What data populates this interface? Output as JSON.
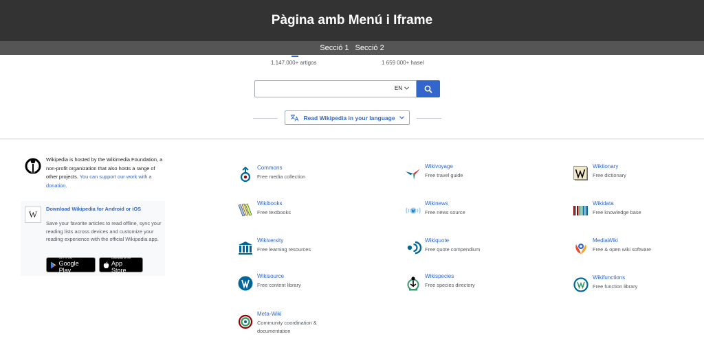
{
  "header": {
    "title": "Pàgina amb Menú i Iframe"
  },
  "nav": {
    "items": [
      "Secció 1",
      "Secció 2"
    ]
  },
  "stats": [
    {
      "text": "1.147.000+ artigos"
    },
    {
      "text": "1 659 000+ hasel"
    }
  ],
  "search": {
    "placeholder": "",
    "language": "EN"
  },
  "read_language_label": "Read Wikipedia in your language",
  "hosted": {
    "text": "Wikipedia is hosted by the Wikimedia Foundation, a non-profit organization that also hosts a range of other projects.",
    "link": "You can support our work with a donation."
  },
  "app": {
    "logo_letter": "W",
    "title": "Download Wikipedia for Android or iOS",
    "description": "Save your favorite articles to read offline, sync your reading lists across devices and customize your reading experience with the official Wikipedia app.",
    "google_small": "GET IT ON",
    "google_big": "Google Play",
    "apple_small": "Download on the",
    "apple_big": "App Store"
  },
  "projects": [
    {
      "name": "Commons",
      "desc": "Free media collection"
    },
    {
      "name": "Wikivoyage",
      "desc": "Free travel guide"
    },
    {
      "name": "Wiktionary",
      "desc": "Free dictionary"
    },
    {
      "name": "Wikibooks",
      "desc": "Free textbooks"
    },
    {
      "name": "Wikinews",
      "desc": "Free news source"
    },
    {
      "name": "Wikidata",
      "desc": "Free knowledge base"
    },
    {
      "name": "Wikiversity",
      "desc": "Free learning resources"
    },
    {
      "name": "Wikiquote",
      "desc": "Free quote compendium"
    },
    {
      "name": "MediaWiki",
      "desc": "Free & open wiki software"
    },
    {
      "name": "Wikisource",
      "desc": "Free content library"
    },
    {
      "name": "Wikispecies",
      "desc": "Free species directory"
    },
    {
      "name": "Wikifunctions",
      "desc": "Free function library"
    },
    {
      "name": "Meta-Wiki",
      "desc": "Community coordination & documentation"
    }
  ],
  "colors": {
    "header_bg": "#333333",
    "nav_bg": "#555555",
    "link": "#3366cc",
    "accent_blue": "#3366cc"
  }
}
